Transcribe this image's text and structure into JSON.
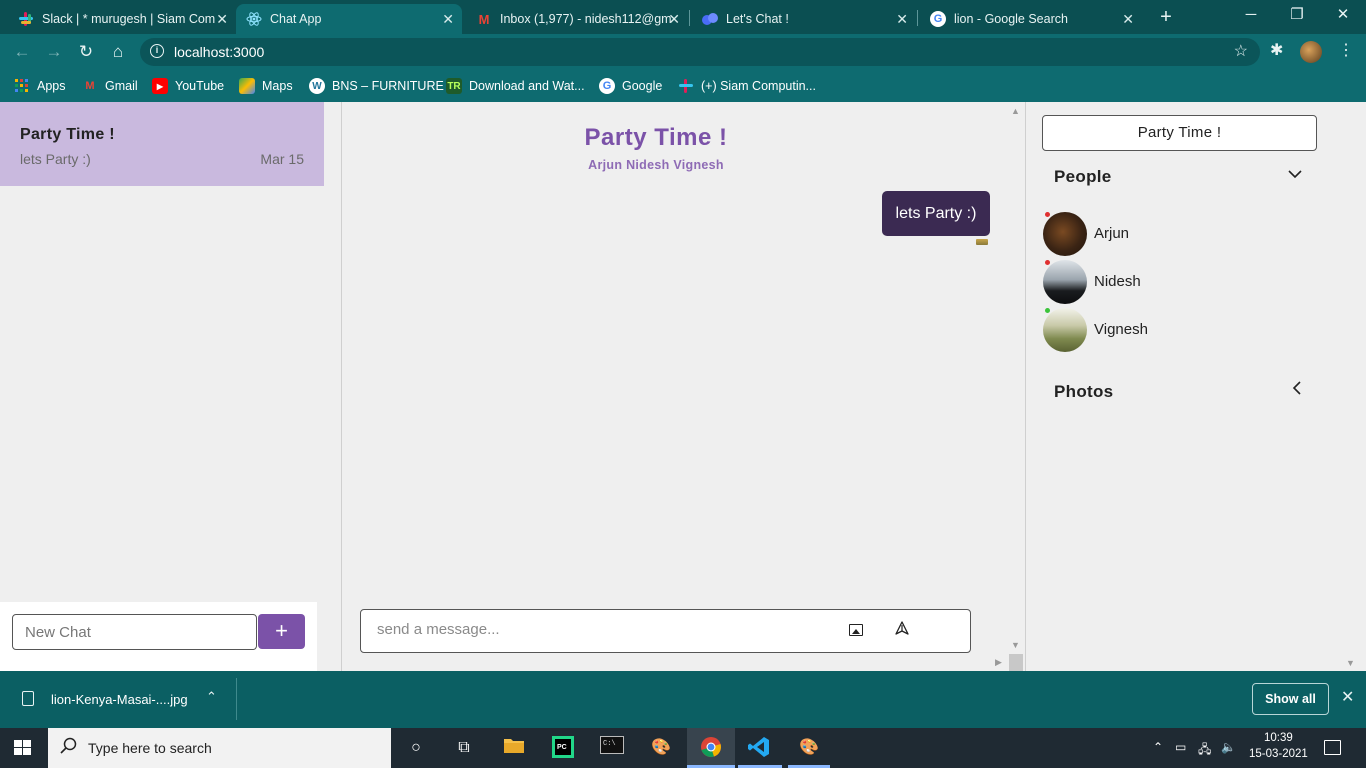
{
  "browser": {
    "tabs": [
      {
        "label": "Slack | * murugesh | Siam Com",
        "icon": "slack-icon",
        "active": false
      },
      {
        "label": "Chat App",
        "icon": "react-icon",
        "active": true
      },
      {
        "label": "Inbox (1,977) - nidesh112@gm",
        "icon": "gmail-icon",
        "active": false
      },
      {
        "label": "Let's Chat !",
        "icon": "chat-logo-icon",
        "active": false
      },
      {
        "label": "lion - Google Search",
        "icon": "google-icon",
        "active": false
      }
    ],
    "url": "localhost:3000",
    "bookmarks": [
      {
        "label": "Apps",
        "icon": "apps-grid-icon"
      },
      {
        "label": "Gmail",
        "icon": "gmail-icon"
      },
      {
        "label": "YouTube",
        "icon": "youtube-icon"
      },
      {
        "label": "Maps",
        "icon": "maps-icon"
      },
      {
        "label": "BNS – FURNITURE",
        "icon": "wordpress-icon"
      },
      {
        "label": "Download and Wat...",
        "icon": "tr-icon"
      },
      {
        "label": "Google",
        "icon": "google-icon"
      },
      {
        "label": "(+) Siam Computin...",
        "icon": "slack-icon"
      }
    ]
  },
  "sidebar": {
    "chats": [
      {
        "name": "Party Time !",
        "last_message": "lets Party :)",
        "date": "Mar 15",
        "selected": true
      }
    ],
    "new_chat_placeholder": "New Chat",
    "add_button": "+"
  },
  "chat": {
    "title": "Party Time !",
    "members": "Arjun Nidesh Vignesh",
    "messages": [
      {
        "text": "lets Party :)",
        "own": true
      }
    ],
    "input_placeholder": "send a message..."
  },
  "details": {
    "title": "Party Time !",
    "people_heading": "People",
    "people": [
      {
        "name": "Arjun",
        "status_color": "#e03030",
        "avatar": "lion-photo"
      },
      {
        "name": "Nidesh",
        "status_color": "#e03030",
        "avatar": "silhouette-photo"
      },
      {
        "name": "Vignesh",
        "status_color": "#3cc43c",
        "avatar": "landscape-photo"
      }
    ],
    "photos_heading": "Photos"
  },
  "downloads": {
    "file_name": "lion-Kenya-Masai-....jpg",
    "show_all": "Show all"
  },
  "taskbar": {
    "search_placeholder": "Type here to search",
    "time": "10:39",
    "date": "15-03-2021"
  },
  "colors": {
    "accent": "#7b52a8",
    "selected_chat": "#c9b9de",
    "own_bubble": "#3b2a52",
    "browser_frame": "#0e6b70"
  }
}
